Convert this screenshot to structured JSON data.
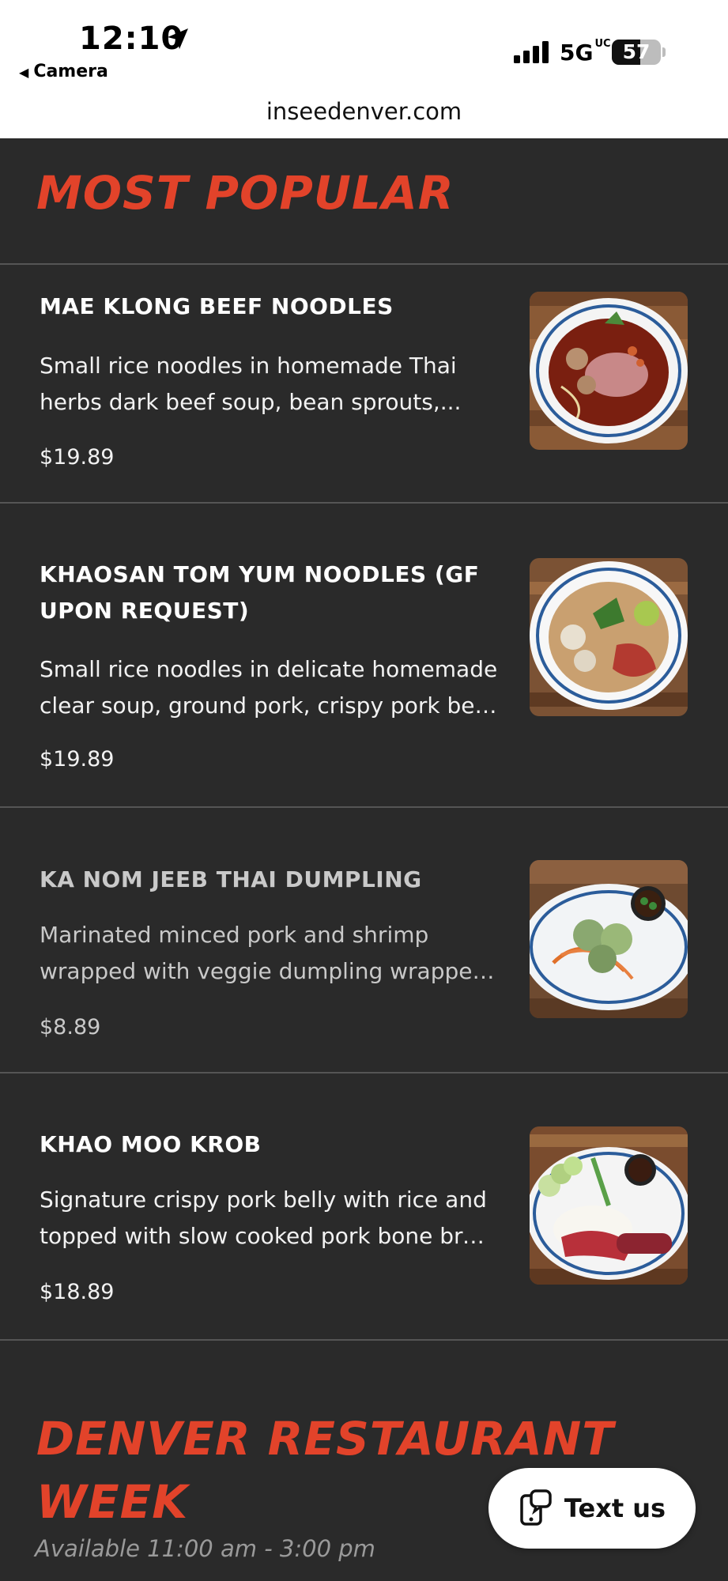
{
  "status_bar": {
    "time": "12:10",
    "back_label": "Camera",
    "network": "5G",
    "network_suffix": "UC",
    "battery": "57",
    "url": "inseedenver.com"
  },
  "sections": {
    "most_popular_title": "MOST POPULAR",
    "restaurant_week_title": "DENVER RESTAURANT WEEK",
    "restaurant_week_hours": "Available 11:00 am - 3:00 pm"
  },
  "menu_items": [
    {
      "name": "MAE KLONG BEEF NOODLES",
      "desc_line1": "Small rice noodles in homemade Thai",
      "desc_line2": "herbs dark beef soup, bean sprouts,...",
      "price": "$19.89"
    },
    {
      "name_line1": "KHAOSAN TOM YUM NOODLES (GF",
      "name_line2": "UPON REQUEST)",
      "desc_line1": "Small rice noodles in delicate homemade",
      "desc_line2": "clear soup, ground pork, crispy pork bell...",
      "price": "$19.89"
    },
    {
      "name": "KA NOM JEEB THAI DUMPLING",
      "desc_line1": "Marinated minced pork and shrimp",
      "desc_line2": "wrapped with veggie dumpling wrapper....",
      "price": "$8.89"
    },
    {
      "name": "KHAO MOO KROB",
      "desc_line1": "Signature crispy pork belly with rice and",
      "desc_line2": "topped with slow cooked pork bone brot...",
      "price": "$18.89"
    }
  ],
  "chat_button": {
    "label": "Text us",
    "icon": "chat-phone-icon"
  },
  "colors": {
    "accent": "#e2432a",
    "background": "#2a2a2a"
  }
}
